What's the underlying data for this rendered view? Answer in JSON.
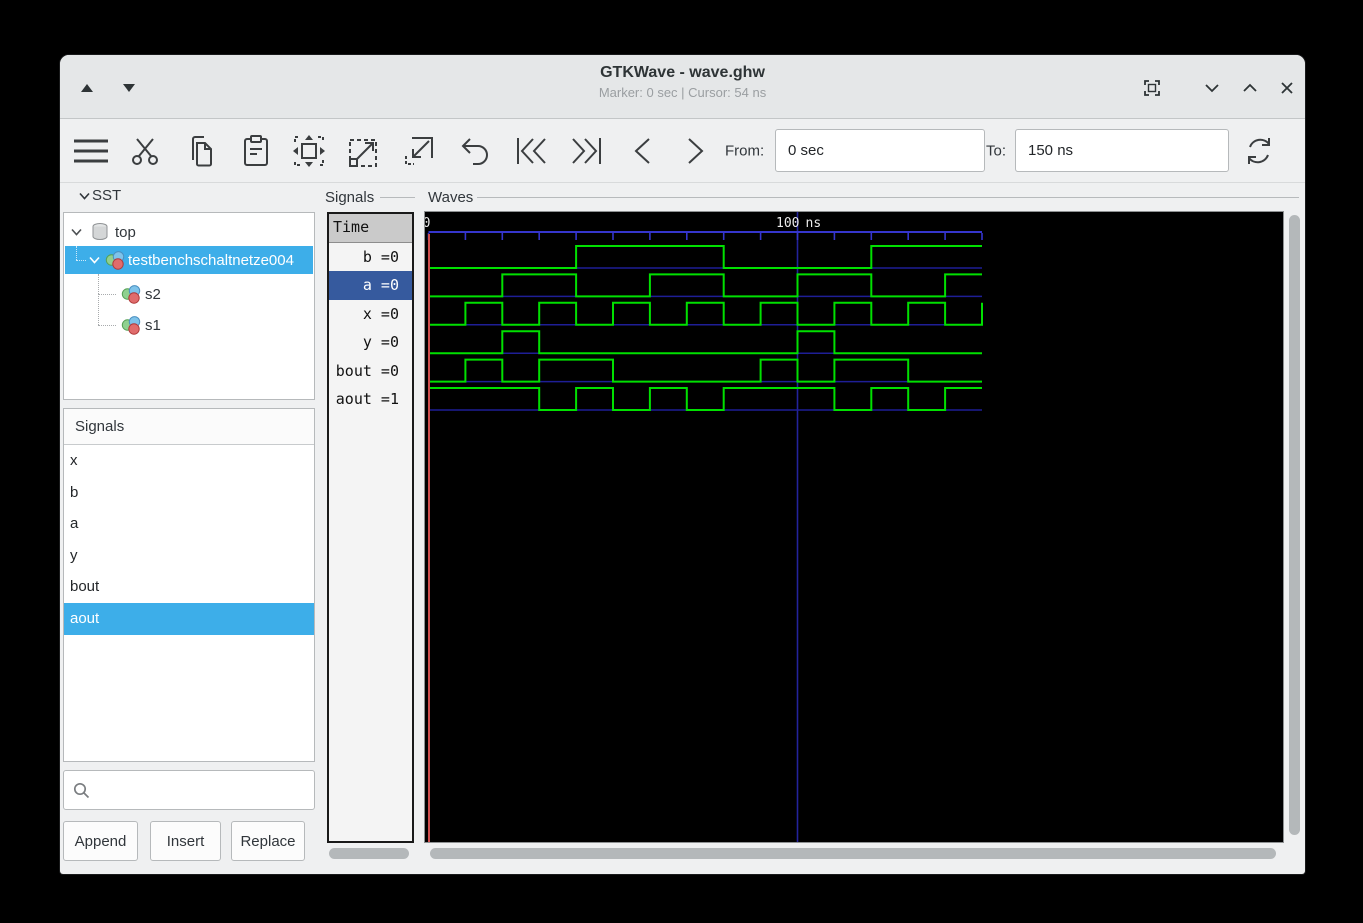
{
  "titlebar": {
    "title": "GTKWave - wave.ghw",
    "subtitle": "Marker: 0 sec  |  Cursor: 54 ns"
  },
  "toolbar": {
    "from_label": "From:",
    "from_value": "0 sec",
    "to_label": "To:",
    "to_value": "150 ns"
  },
  "sst": {
    "label": "SST",
    "items": [
      {
        "label": "top"
      },
      {
        "label": "testbenchschaltnetze004"
      },
      {
        "label": "s2"
      },
      {
        "label": "s1"
      }
    ],
    "selected_item": "testbenchschaltnetze004"
  },
  "signal_browser": {
    "header": "Signals",
    "items": [
      "x",
      "b",
      "a",
      "y",
      "bout",
      "aout"
    ],
    "selected_item": "aout",
    "search_value": "",
    "buttons": [
      "Append",
      "Insert",
      "Replace"
    ]
  },
  "signals_panel": {
    "frame_label": "Signals",
    "time_header": "Time",
    "rows": [
      "b =0",
      "a =0",
      "x =0",
      "y =0",
      "bout =0",
      "aout =1"
    ],
    "selected_row": "a =0"
  },
  "waves_panel": {
    "frame_label": "Waves"
  },
  "chart_data": {
    "type": "digital-waveform",
    "time_unit": "ns",
    "t_start": 0,
    "t_end": 150,
    "timeline": {
      "labels": [
        {
          "t": 0,
          "text": "0"
        },
        {
          "t": 100,
          "text": "100 ns"
        }
      ],
      "minor_tick_ns": 10,
      "major_gridline_t": 100
    },
    "marker_t": 0,
    "cursor_t": 54,
    "signals": [
      {
        "name": "b",
        "value_at_marker": 0,
        "high_intervals": [
          [
            40,
            80
          ],
          [
            120,
            150
          ]
        ]
      },
      {
        "name": "a",
        "value_at_marker": 0,
        "high_intervals": [
          [
            20,
            40
          ],
          [
            60,
            80
          ],
          [
            100,
            120
          ],
          [
            140,
            150
          ]
        ]
      },
      {
        "name": "x",
        "value_at_marker": 0,
        "high_intervals": [
          [
            10,
            20
          ],
          [
            30,
            40
          ],
          [
            50,
            60
          ],
          [
            70,
            80
          ],
          [
            90,
            100
          ],
          [
            110,
            120
          ],
          [
            130,
            140
          ],
          [
            150,
            150
          ]
        ]
      },
      {
        "name": "y",
        "value_at_marker": 0,
        "high_intervals": [
          [
            20,
            30
          ],
          [
            100,
            110
          ]
        ]
      },
      {
        "name": "bout",
        "value_at_marker": 0,
        "high_intervals": [
          [
            10,
            20
          ],
          [
            30,
            50
          ],
          [
            90,
            100
          ],
          [
            110,
            130
          ]
        ]
      },
      {
        "name": "aout",
        "value_at_marker": 1,
        "high_intervals": [
          [
            0,
            30
          ],
          [
            40,
            50
          ],
          [
            60,
            70
          ],
          [
            80,
            110
          ],
          [
            120,
            130
          ],
          [
            140,
            150
          ]
        ]
      }
    ],
    "colors": {
      "background": "#000000",
      "trace": "#00e000",
      "baseline": "#1e1e96",
      "timeline": "#3535cd",
      "gridline": "#23239b",
      "marker": "#cf4f4f",
      "label_text": "#ececec"
    }
  },
  "colors": {
    "highlight": "#3daee9",
    "selected_signal_row": "#365a9e"
  }
}
